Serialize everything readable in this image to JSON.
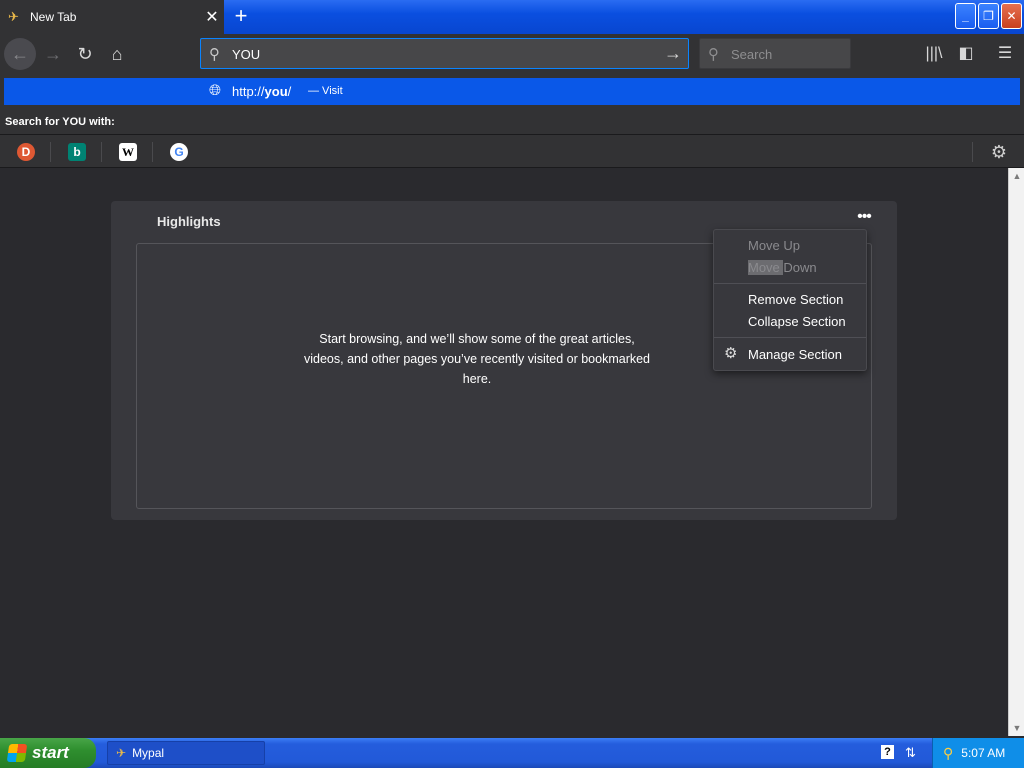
{
  "window": {
    "tab_title": "New Tab",
    "tab_close": "✕",
    "new_tab": "+",
    "minimize": "_",
    "restore": "❐",
    "close": "✕"
  },
  "navbar": {
    "back": "←",
    "forward": "→",
    "reload": "↻",
    "home": "⌂",
    "url_value": "YOU",
    "go": "→",
    "search_placeholder": "Search",
    "library": "|||\\",
    "sidebar": "◧",
    "menu": "☰"
  },
  "suggestion": {
    "url_prefix": "http://",
    "url_bold": "you",
    "url_suffix": "/",
    "action": "— Visit"
  },
  "search_with": "Search for YOU with:",
  "engines": [
    {
      "name": "DuckDuckGo",
      "glyph": "D",
      "color": "#de5833"
    },
    {
      "name": "Bing",
      "glyph": "b",
      "color": "#008373"
    },
    {
      "name": "Wikipedia",
      "glyph": "W",
      "color": "#ffffff"
    },
    {
      "name": "Google",
      "glyph": "G",
      "color": "#ffffff"
    }
  ],
  "highlights": {
    "title": "Highlights",
    "more": "•••",
    "empty_message": "Start browsing, and we’ll show some of the great articles, videos, and other pages you’ve recently visited or bookmarked here."
  },
  "context_menu": {
    "move_up": "Move Up",
    "move_down_sel": "Move ",
    "move_down_rest": "Down",
    "remove": "Remove Section",
    "collapse": "Collapse Section",
    "manage": "Manage Section"
  },
  "taskbar": {
    "start": "start",
    "task_label": "Mypal",
    "help": "?",
    "clock": "5:07 AM"
  }
}
